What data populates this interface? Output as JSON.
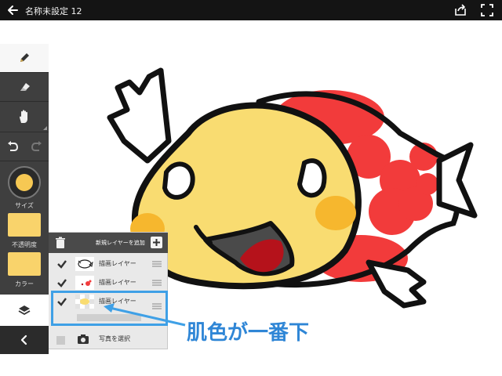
{
  "window": {
    "title": "名称未設定 12",
    "back_icon": "arrow-left-icon",
    "share_icon": "share-icon",
    "fullscreen_icon": "fullscreen-icon"
  },
  "toolbar": {
    "tools": [
      "pencil-icon",
      "eraser-icon",
      "hand-icon"
    ],
    "undo_icon": "undo-icon",
    "redo_icon": "redo-icon",
    "size_label": "サイズ",
    "opacity_label": "不透明度",
    "color_label": "カラー",
    "brush_color": "#f6c853",
    "layers_icon": "layers-icon",
    "collapse_icon": "chevron-left-icon"
  },
  "layer_panel": {
    "add_label": "新規レイヤーを追加",
    "layers": [
      {
        "name": "描画レイヤー",
        "checked": true
      },
      {
        "name": "描画レイヤー",
        "checked": true
      },
      {
        "name": "描画レイヤー",
        "checked": true
      }
    ],
    "photo_label": "写真を選択"
  },
  "annotation": {
    "caption": "肌色が一番下",
    "color": "#3fa0e6"
  },
  "colors": {
    "skin": "#f9dc71",
    "red": "#f23b3b",
    "mouth": "#b5121b",
    "cheek": "#f6b72e"
  }
}
